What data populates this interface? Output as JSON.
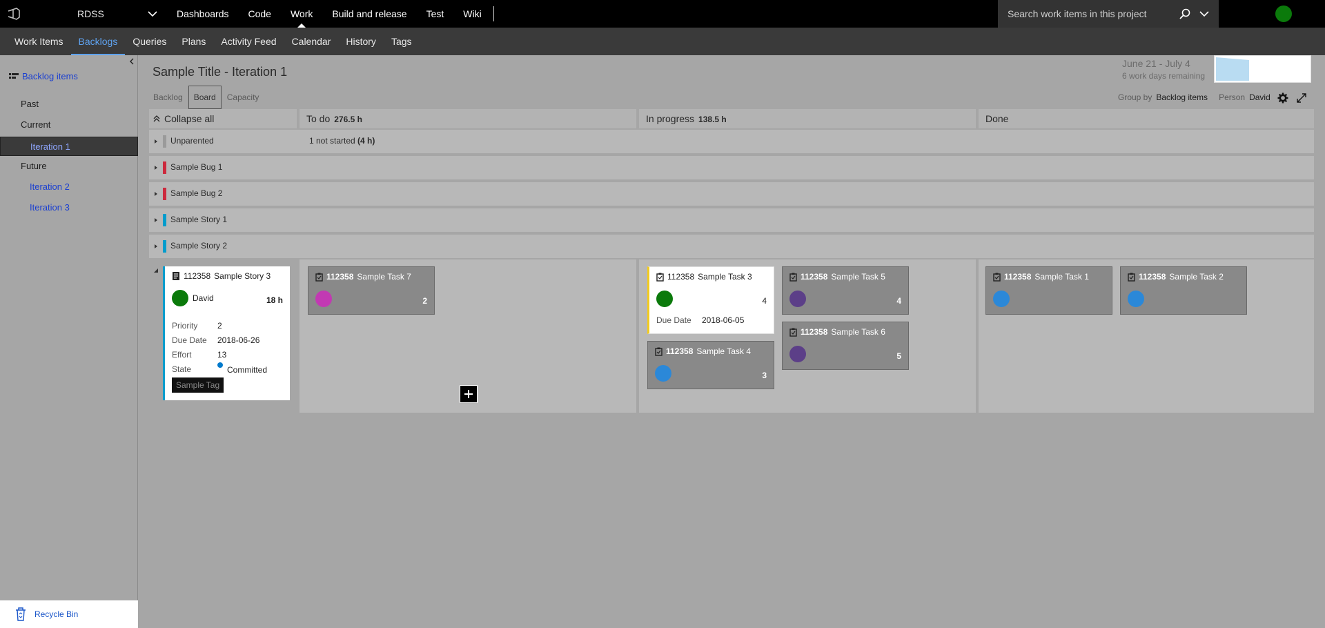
{
  "topbar": {
    "project": "RDSS",
    "nav": [
      "Dashboards",
      "Code",
      "Work",
      "Build and release",
      "Test",
      "Wiki"
    ],
    "active_nav": "Work",
    "search_placeholder": "Search work items in this project",
    "avatar_color": "#0b7a0b"
  },
  "subnav": {
    "items": [
      "Work Items",
      "Backlogs",
      "Queries",
      "Plans",
      "Activity Feed",
      "Calendar",
      "History",
      "Tags"
    ],
    "active": "Backlogs"
  },
  "sidebar": {
    "backlog_label": "Backlog items",
    "past": "Past",
    "current": "Current",
    "current_iteration": "Iteration 1",
    "future": "Future",
    "future_iterations": [
      "Iteration 2",
      "Iteration 3"
    ],
    "recycle_bin": "Recycle Bin"
  },
  "header": {
    "title": "Sample Title - Iteration 1",
    "dates": "June 21 - July 4",
    "workdays": "6 work days remaining",
    "pivots": [
      "Backlog",
      "Board",
      "Capacity"
    ],
    "active_pivot": "Board",
    "group_by_label": "Group by",
    "group_by_value": "Backlog items",
    "person_label": "Person",
    "person_value": "David"
  },
  "board": {
    "collapse_all": "Collapse all",
    "columns": [
      {
        "name": "To do",
        "hours": "276.5 h"
      },
      {
        "name": "In progress",
        "hours": "138.5 h"
      },
      {
        "name": "Done",
        "hours": ""
      }
    ],
    "rows": [
      {
        "title": "Unparented",
        "color": "#9a9a9a",
        "summary": "1 not started ",
        "summary_bold": "(4 h)"
      },
      {
        "title": "Sample Bug 1",
        "color": "#cc293d",
        "summary": "",
        "summary_bold": ""
      },
      {
        "title": "Sample Bug 2",
        "color": "#cc293d",
        "summary": "",
        "summary_bold": ""
      },
      {
        "title": "Sample Story 1",
        "color": "#009ccc",
        "summary": "",
        "summary_bold": ""
      },
      {
        "title": "Sample Story 2",
        "color": "#009ccc",
        "summary": "",
        "summary_bold": ""
      }
    ],
    "story": {
      "id": "112358",
      "title": "Sample Story 3",
      "owner": "David",
      "hours": "18 h",
      "fields": [
        {
          "label": "Priority",
          "value": "2"
        },
        {
          "label": "Due Date",
          "value": "2018-06-26"
        },
        {
          "label": "Effort",
          "value": "13"
        },
        {
          "label": "State",
          "value": "Committed"
        }
      ],
      "tag": "Sample Tag"
    },
    "tasks": {
      "t7": {
        "id": "112358",
        "title": "Sample Task 7",
        "estimate": "2",
        "color": "#c239b3"
      },
      "t3": {
        "id": "112358",
        "title": "Sample Task 3",
        "estimate": "4",
        "color": "#0b7a0b",
        "due_label": "Due Date",
        "due_value": "2018-06-05"
      },
      "t4": {
        "id": "112358",
        "title": "Sample Task 4",
        "estimate": "3",
        "color": "#2b88d8"
      },
      "t5": {
        "id": "112358",
        "title": "Sample Task 5",
        "estimate": "4",
        "color": "#5c3f88"
      },
      "t6": {
        "id": "112358",
        "title": "Sample Task 6",
        "estimate": "5",
        "color": "#5c3f88"
      },
      "t1": {
        "id": "112358",
        "title": "Sample Task 1",
        "estimate": "",
        "color": "#2b88d8"
      },
      "t2": {
        "id": "112358",
        "title": "Sample Task 2",
        "estimate": "",
        "color": "#2b88d8"
      }
    }
  }
}
